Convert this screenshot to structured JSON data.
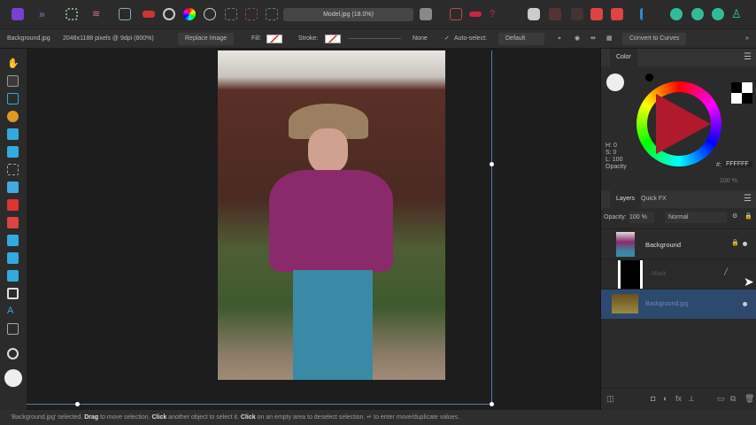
{
  "toolbar": {
    "document_title": "Model.jpg (18.0%)"
  },
  "context": {
    "layer_name": "Background.jpg",
    "image_info": "2048x1188 pixels @ 9dpi (800%)",
    "replace_label": "Replace Image",
    "fill_label": "Fill:",
    "stroke_label": "Stroke:",
    "stroke_width": "None",
    "auto_select_label": "Auto-select:",
    "auto_select_value": "Default",
    "convert_label": "Convert to Curves"
  },
  "color_panel": {
    "tab": "Color",
    "h": "H: 0",
    "s": "S: 0",
    "l": "L: 100",
    "opacity_label": "Opacity",
    "hex_label": "#:",
    "hex": "FFFFFF",
    "opacity_value": "100 %"
  },
  "layers_panel": {
    "tabs": [
      "Layers",
      "Quick FX"
    ],
    "opacity_label": "Opacity:",
    "opacity_value": "100 %",
    "blend_mode": "Normal",
    "layers": [
      {
        "name": "Background"
      },
      {
        "name": "Mask"
      },
      {
        "name": "Background.jpg"
      }
    ]
  },
  "status": {
    "quote": "'Background.jpg' selected. ",
    "drag": "Drag",
    "t1": " to move selection. ",
    "click1": "Click",
    "t2": " another object to select it. ",
    "click2": "Click",
    "t3": " on an empty area to deselect selection. ↵ to enter move/duplicate values."
  },
  "colors": {
    "accent": "#2d4a6e",
    "app_icon": "#7a3fd0"
  }
}
